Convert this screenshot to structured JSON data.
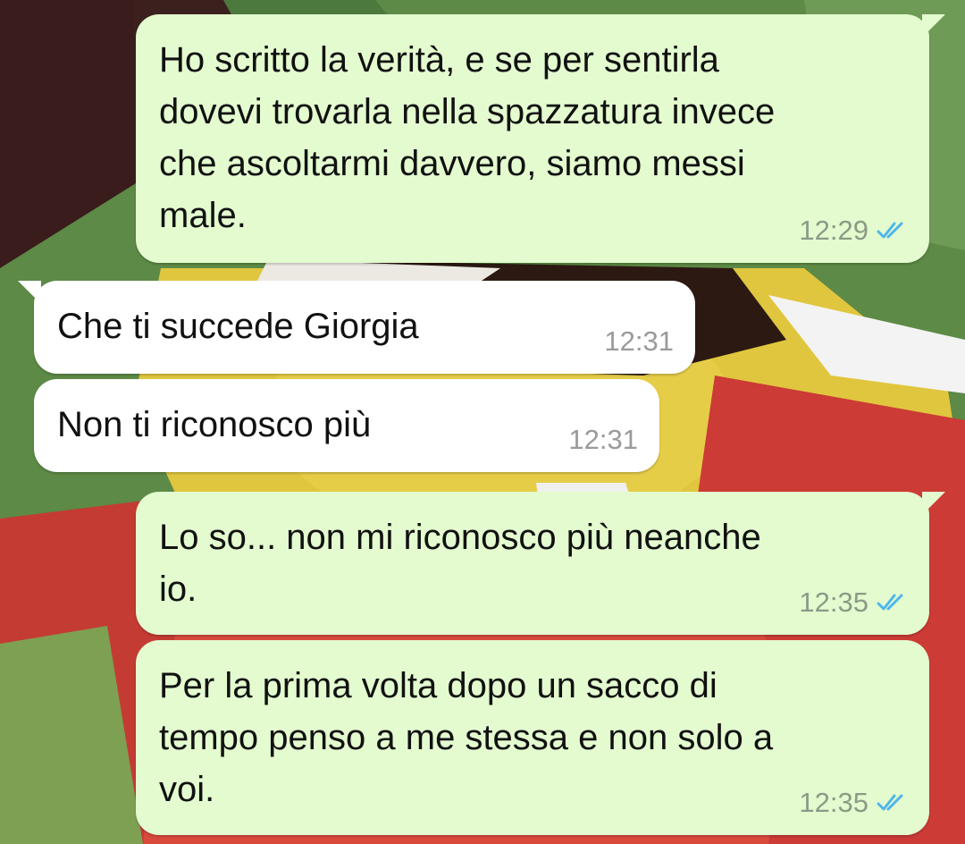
{
  "chat": {
    "messages": [
      {
        "direction": "outgoing",
        "text": "Ho scritto la verità,  e se per sentirla\ndovevi trovarla nella spazzatura invece\nche ascoltarmi davvero, siamo messi\nmale.",
        "time": "12:29",
        "status_icon": "double-check-read-icon"
      },
      {
        "direction": "incoming",
        "text": "Che ti succede Giorgia",
        "time": "12:31"
      },
      {
        "direction": "incoming",
        "text": "Non ti riconosco più",
        "time": "12:31"
      },
      {
        "direction": "outgoing",
        "text": "Lo so... non mi riconosco più neanche\nio.",
        "time": "12:35",
        "status_icon": "double-check-read-icon"
      },
      {
        "direction": "outgoing",
        "text": "Per la prima volta dopo un sacco di\ntempo penso a me stessa e non solo a\nvoi.",
        "time": "12:35",
        "status_icon": "double-check-read-icon"
      }
    ]
  },
  "colors": {
    "outgoing_bubble": "#e3fbcf",
    "incoming_bubble": "#ffffff",
    "read_ticks": "#4fb6ec"
  }
}
